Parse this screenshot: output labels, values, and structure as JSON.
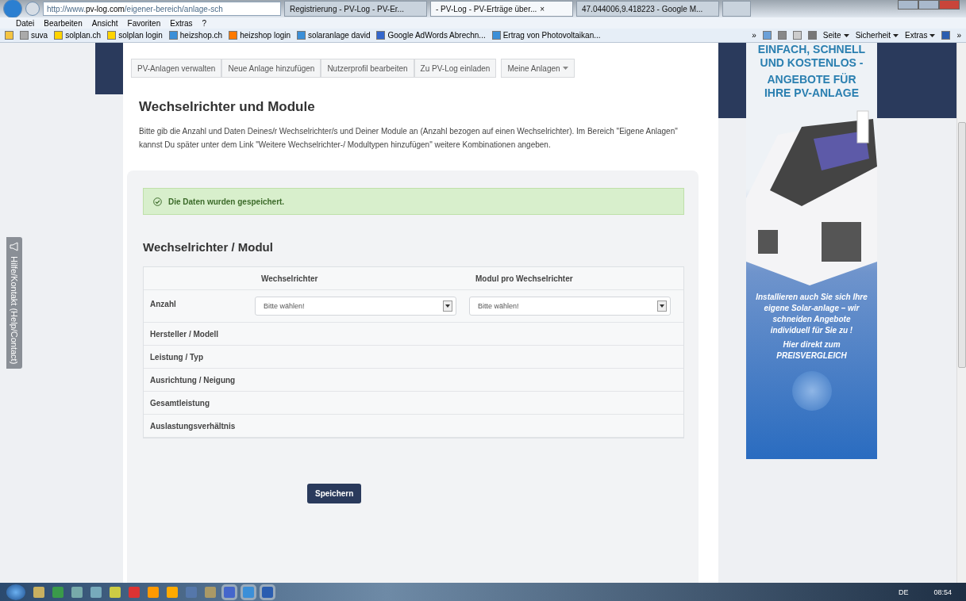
{
  "browser": {
    "address": "http://www.**pv-log.com**/eigener-bereich/anlage-sch",
    "tabs": [
      {
        "title": "Registrierung - PV-Log - PV-Er...",
        "selected": false
      },
      {
        "title": "- PV-Log - PV-Erträge über...",
        "selected": true,
        "close": "×"
      },
      {
        "title": "47.044006,9.418223 - Google M...",
        "selected": false
      }
    ],
    "menu": [
      "Datei",
      "Bearbeiten",
      "Ansicht",
      "Favoriten",
      "Extras",
      "?"
    ],
    "favorites": [
      "suva",
      "solplan.ch",
      "solplan login",
      "heizshop.ch",
      "heizshop login",
      "solaranlage david",
      "Google AdWords Abrechn...",
      "Ertrag von Photovoltaikan..."
    ],
    "command_bar": [
      "Seite",
      "Sicherheit",
      "Extras"
    ],
    "chevron": "»"
  },
  "feedback_tab": "Hilfe/Kontakt (Help/Contact)",
  "nav": [
    {
      "label": "PV-Anlagen verwalten",
      "kind": "button"
    },
    {
      "label": "Neue Anlage hinzufügen",
      "kind": "button"
    },
    {
      "label": "Nutzerprofil bearbeiten",
      "kind": "button"
    },
    {
      "label": "Zu PV-Log einladen",
      "kind": "button"
    },
    {
      "label": "Meine Anlagen",
      "kind": "dropdown"
    }
  ],
  "title": "Wechselrichter und Module",
  "intro": "Bitte gib die Anzahl und Daten Deines/r Wechselrichter/s und Deiner Module an (Anzahl bezogen auf einen Wechselrichter). Im Bereich \"Eigene Anlagen\" kannst Du später unter dem Link \"Weitere Wechselrichter-/ Modultypen hinzufügen\" weitere Kombinationen angeben.",
  "alert": "Die Daten wurden gespeichert.",
  "section_title": "Wechselrichter / Modul",
  "table": {
    "columns": [
      "Wechselrichter",
      "Modul pro Wechselrichter"
    ],
    "rows": [
      {
        "label": "Anzahl",
        "kind": "select",
        "values": [
          "Bitte wählen!",
          "Bitte wählen!"
        ]
      },
      {
        "label": "Hersteller / Modell",
        "kind": "text"
      },
      {
        "label": "Leistung / Typ",
        "kind": "text"
      },
      {
        "label": "Ausrichtung / Neigung",
        "kind": "text"
      },
      {
        "label": "Gesamtleistung",
        "kind": "text"
      },
      {
        "label": "Auslastungsverhältnis",
        "kind": "text"
      }
    ]
  },
  "save_button": "Speichern",
  "ad": {
    "headline": [
      "EINFACH, SCHNELL",
      "UND KOSTENLOS -",
      "ANGEBOTE FÜR",
      "IHRE PV-ANLAGE"
    ],
    "body": "Installieren auch Sie sich Ihre eigene Solar-anlage – wir schneiden Angebote individuell für Sie zu !",
    "cta": "Hier direkt zum PREISVERGLEICH"
  },
  "taskbar": {
    "language": "DE",
    "time": "08:54"
  }
}
